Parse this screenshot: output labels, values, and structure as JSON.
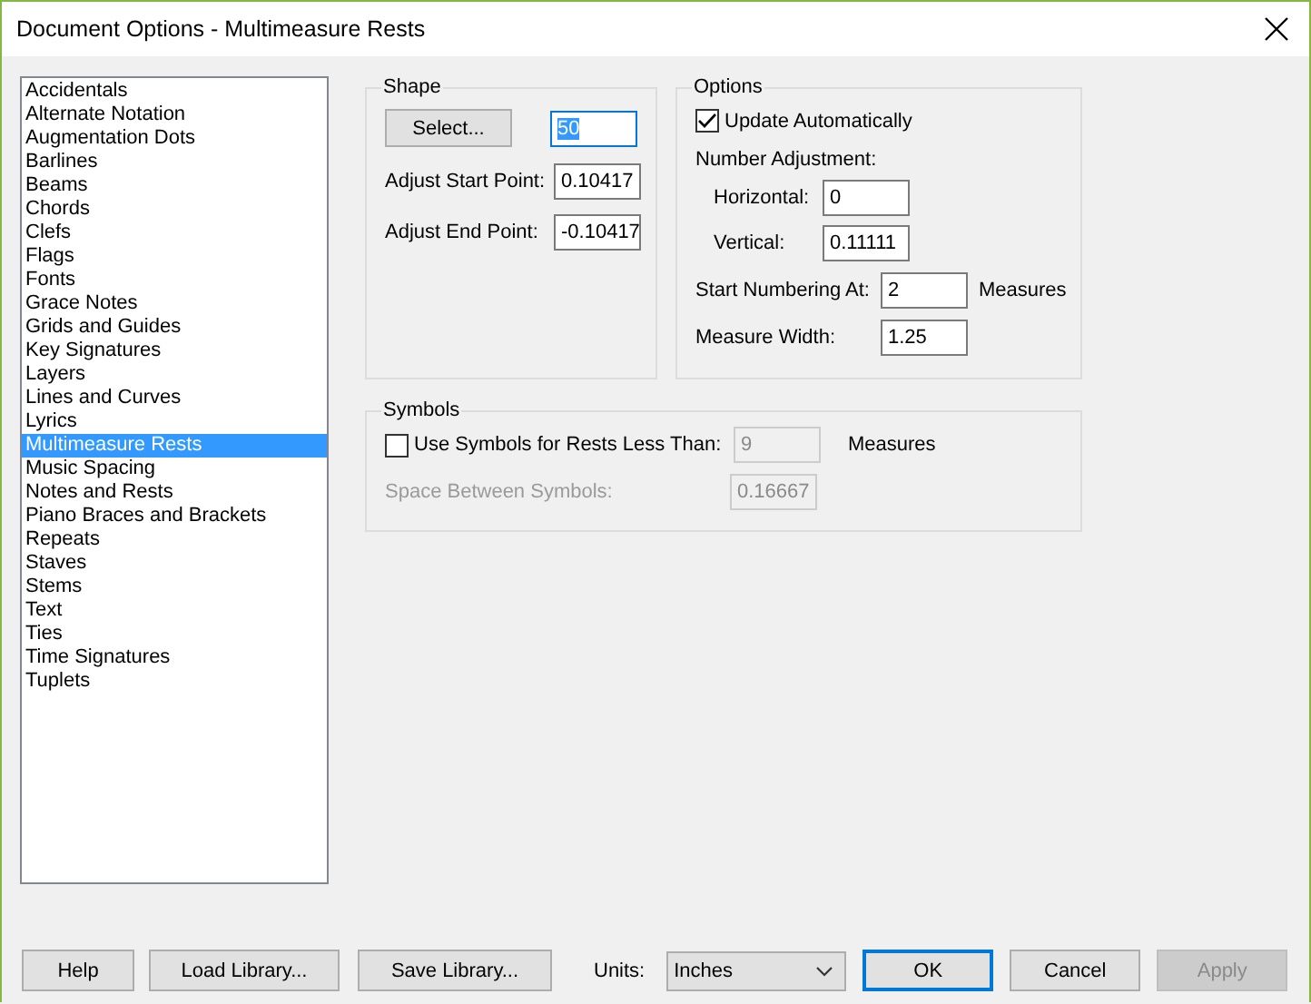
{
  "window": {
    "title": "Document Options - Multimeasure Rests"
  },
  "sidebar": {
    "items": [
      {
        "label": "Accidentals",
        "selected": false
      },
      {
        "label": "Alternate Notation",
        "selected": false
      },
      {
        "label": "Augmentation Dots",
        "selected": false
      },
      {
        "label": "Barlines",
        "selected": false
      },
      {
        "label": "Beams",
        "selected": false
      },
      {
        "label": "Chords",
        "selected": false
      },
      {
        "label": "Clefs",
        "selected": false
      },
      {
        "label": "Flags",
        "selected": false
      },
      {
        "label": "Fonts",
        "selected": false
      },
      {
        "label": "Grace Notes",
        "selected": false
      },
      {
        "label": "Grids and Guides",
        "selected": false
      },
      {
        "label": "Key Signatures",
        "selected": false
      },
      {
        "label": "Layers",
        "selected": false
      },
      {
        "label": "Lines and Curves",
        "selected": false
      },
      {
        "label": "Lyrics",
        "selected": false
      },
      {
        "label": "Multimeasure Rests",
        "selected": true
      },
      {
        "label": "Music Spacing",
        "selected": false
      },
      {
        "label": "Notes and Rests",
        "selected": false
      },
      {
        "label": "Piano Braces and Brackets",
        "selected": false
      },
      {
        "label": "Repeats",
        "selected": false
      },
      {
        "label": "Staves",
        "selected": false
      },
      {
        "label": "Stems",
        "selected": false
      },
      {
        "label": "Text",
        "selected": false
      },
      {
        "label": "Ties",
        "selected": false
      },
      {
        "label": "Time Signatures",
        "selected": false
      },
      {
        "label": "Tuplets",
        "selected": false
      }
    ]
  },
  "shape": {
    "title": "Shape",
    "button": "Select...",
    "value": "50",
    "value_selected": true,
    "fields": [
      {
        "label": "Adjust Start Point:",
        "value": "0.10417"
      },
      {
        "label": "Adjust End Point:",
        "value": "-0.10417"
      }
    ]
  },
  "options": {
    "title": "Options",
    "update": {
      "label": "Update Automatically",
      "checked": true
    },
    "number_adjustment": {
      "label": "Number Adjustment:",
      "fields": [
        {
          "label": "Horizontal:",
          "value": "0"
        },
        {
          "label": "Vertical:",
          "value": "0.11111"
        }
      ]
    },
    "start_numbering": {
      "label": "Start Numbering At:",
      "value": "2",
      "unit": "Measures"
    },
    "measure_width": {
      "label": "Measure Width:",
      "value": "1.25"
    }
  },
  "symbols": {
    "title": "Symbols",
    "use_symbols": {
      "label": "Use Symbols for Rests Less Than:",
      "checked": false,
      "value": "9",
      "disabled": true,
      "unit": "Measures"
    },
    "space_between": {
      "label": "Space Between Symbols:",
      "value": "0.16667",
      "disabled": true
    }
  },
  "footer": {
    "buttons": [
      {
        "label": "Help"
      },
      {
        "label": "Load Library..."
      },
      {
        "label": "Save Library..."
      }
    ],
    "units": {
      "label": "Units:",
      "value": "Inches"
    },
    "actions": [
      {
        "label": "OK",
        "default": true,
        "disabled": false
      },
      {
        "label": "Cancel",
        "default": false,
        "disabled": false
      },
      {
        "label": "Apply",
        "default": false,
        "disabled": true
      }
    ]
  }
}
